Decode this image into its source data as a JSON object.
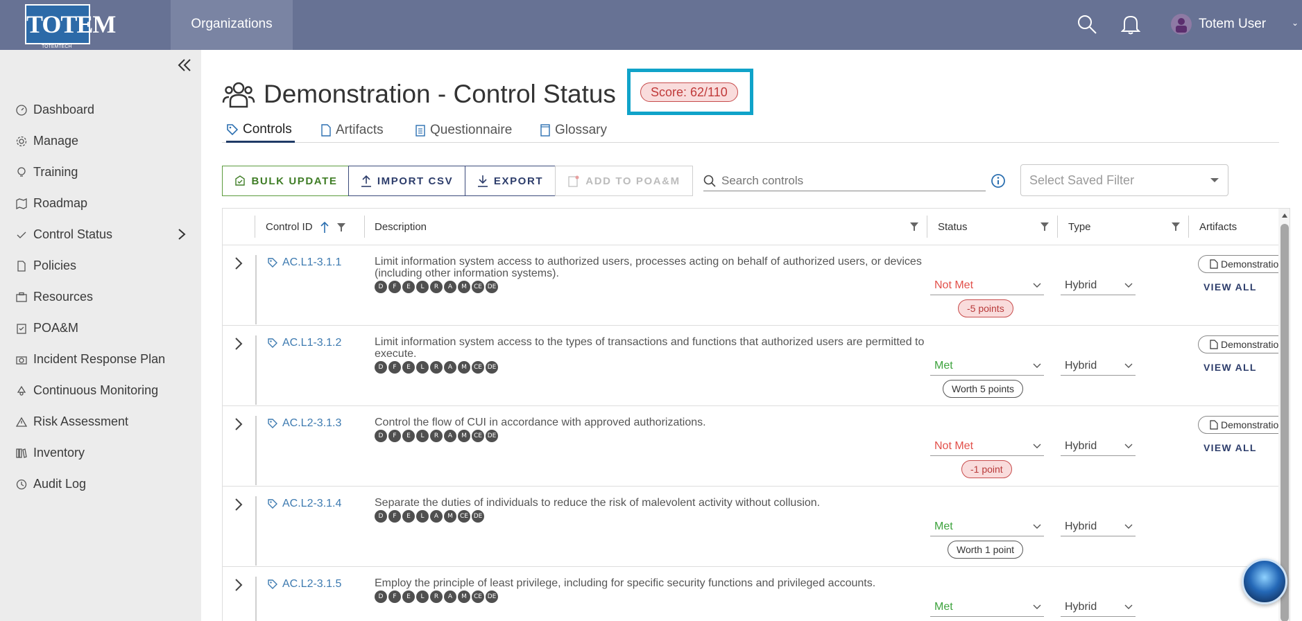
{
  "brand": {
    "logo_text": "TOTEM",
    "logo_sub": "TOTEMTECH"
  },
  "topbar": {
    "org_tab": "Organizations",
    "user_name": "Totem User",
    "icons": [
      "search-icon",
      "bell-icon",
      "user-avatar-icon",
      "chevron-down-icon"
    ]
  },
  "sidebar": {
    "items": [
      {
        "label": "Dashboard",
        "icon": "dashboard-icon"
      },
      {
        "label": "Manage",
        "icon": "gear-icon"
      },
      {
        "label": "Training",
        "icon": "lightbulb-icon"
      },
      {
        "label": "Roadmap",
        "icon": "map-icon"
      },
      {
        "label": "Control Status",
        "icon": "check-icon"
      },
      {
        "label": "Policies",
        "icon": "document-icon"
      },
      {
        "label": "Resources",
        "icon": "briefcase-icon"
      },
      {
        "label": "POA&M",
        "icon": "clipboard-icon"
      },
      {
        "label": "Incident Response Plan",
        "icon": "camera-icon"
      },
      {
        "label": "Continuous Monitoring",
        "icon": "recycle-icon"
      },
      {
        "label": "Risk Assessment",
        "icon": "warning-icon"
      },
      {
        "label": "Inventory",
        "icon": "library-icon"
      },
      {
        "label": "Audit Log",
        "icon": "history-icon"
      }
    ]
  },
  "header": {
    "title": "Demonstration - Control Status",
    "score": "Score: 62/110"
  },
  "tabs": [
    {
      "label": "Controls",
      "icon": "tag-icon"
    },
    {
      "label": "Artifacts",
      "icon": "file-icon"
    },
    {
      "label": "Questionnaire",
      "icon": "clipboard-icon"
    },
    {
      "label": "Glossary",
      "icon": "book-icon"
    }
  ],
  "toolbar": {
    "bulk_update": "BULK UPDATE",
    "import_csv": "IMPORT CSV",
    "export": "EXPORT",
    "add_to_poam": "ADD TO POA&M",
    "search_placeholder": "Search controls",
    "saved_filter_placeholder": "Select Saved Filter"
  },
  "table": {
    "columns": {
      "control_id": "Control ID",
      "description": "Description",
      "status": "Status",
      "type": "Type",
      "artifacts": "Artifacts"
    },
    "rows": [
      {
        "id": "AC.L1-3.1.1",
        "description": "Limit information system access to authorized users, processes acting on behalf of authorized users, or devices (including other information systems).",
        "badges": [
          "D",
          "F",
          "E",
          "L",
          "R",
          "A",
          "M",
          "CE",
          "DE"
        ],
        "status": "Not Met",
        "points": "-5 points",
        "type": "Hybrid",
        "artifact": "Demonstration",
        "view_all": "VIEW ALL"
      },
      {
        "id": "AC.L1-3.1.2",
        "description": "Limit information system access to the types of transactions and functions that authorized users are permitted to execute.",
        "badges": [
          "D",
          "F",
          "E",
          "L",
          "R",
          "A",
          "M",
          "CE",
          "DE"
        ],
        "status": "Met",
        "points": "Worth 5 points",
        "type": "Hybrid",
        "artifact": "Demonstration",
        "view_all": "VIEW ALL"
      },
      {
        "id": "AC.L2-3.1.3",
        "description": "Control the flow of CUI in accordance with approved authorizations.",
        "badges": [
          "D",
          "F",
          "E",
          "L",
          "R",
          "A",
          "M",
          "CE",
          "DE"
        ],
        "status": "Not Met",
        "points": "-1 point",
        "type": "Hybrid",
        "artifact": "Demonstration",
        "view_all": "VIEW ALL"
      },
      {
        "id": "AC.L2-3.1.4",
        "description": "Separate the duties of individuals to reduce the risk of malevolent activity without collusion.",
        "badges": [
          "D",
          "F",
          "E",
          "L",
          "A",
          "M",
          "CE",
          "DE"
        ],
        "status": "Met",
        "points": "Worth 1 point",
        "type": "Hybrid",
        "artifact": "",
        "view_all": ""
      },
      {
        "id": "AC.L2-3.1.5",
        "description": "Employ the principle of least privilege, including for specific security functions and privileged accounts.",
        "badges": [
          "D",
          "F",
          "E",
          "L",
          "R",
          "A",
          "M",
          "CE",
          "DE"
        ],
        "status": "Met",
        "points": "",
        "type": "Hybrid",
        "artifact": "",
        "view_all": ""
      }
    ]
  },
  "colors": {
    "topbar": "#677294",
    "accent_cyan": "#10a3c9",
    "not_met": "#e2504a",
    "met": "#3ea33e",
    "link": "#3d7ab0",
    "navy": "#2d3d6b"
  }
}
